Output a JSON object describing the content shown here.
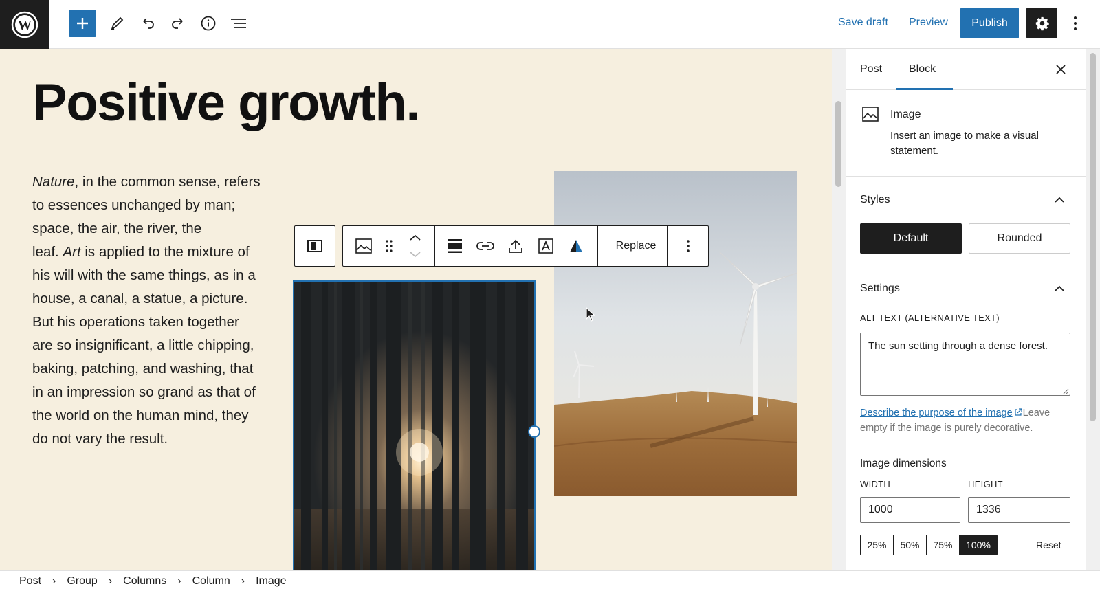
{
  "toolbar": {
    "logo_icon": "wordpress-icon",
    "save_draft": "Save draft",
    "preview": "Preview",
    "publish": "Publish"
  },
  "post": {
    "title": "Positive growth.",
    "paragraph_lines": [
      [
        {
          "t": "Nature",
          "i": true
        },
        {
          "t": ", in the common sense, refers",
          "i": false
        }
      ],
      [
        {
          "t": "to essences unchanged by man;",
          "i": false
        }
      ],
      [
        {
          "t": "space, the air, the river, the",
          "i": false
        }
      ],
      [
        {
          "t": "leaf. ",
          "i": false
        },
        {
          "t": "Art",
          "i": true
        },
        {
          "t": " is applied to the mixture of",
          "i": false
        }
      ],
      [
        {
          "t": "his will with the same things, as in a",
          "i": false
        }
      ],
      [
        {
          "t": "house, a canal, a statue, a picture.",
          "i": false
        }
      ],
      [
        {
          "t": "But his operations taken together",
          "i": false
        }
      ],
      [
        {
          "t": "are so insignificant, a little chipping,",
          "i": false
        }
      ],
      [
        {
          "t": "baking, patching, and washing, that",
          "i": false
        }
      ],
      [
        {
          "t": "in an impression so grand as that of",
          "i": false
        }
      ],
      [
        {
          "t": "the world on the human mind, they",
          "i": false
        }
      ],
      [
        {
          "t": "do not vary the result.",
          "i": false
        }
      ]
    ]
  },
  "block_toolbar": {
    "replace": "Replace"
  },
  "breadcrumb": [
    "Post",
    "Group",
    "Columns",
    "Column",
    "Image"
  ],
  "sidebar": {
    "tabs": {
      "post": "Post",
      "block": "Block"
    },
    "active_tab": "Block",
    "block_name": "Image",
    "block_description": "Insert an image to make a visual statement.",
    "styles": {
      "title": "Styles",
      "default": "Default",
      "rounded": "Rounded",
      "selected": "Default"
    },
    "settings": {
      "title": "Settings",
      "alt_label": "ALT TEXT (ALTERNATIVE TEXT)",
      "alt_value": "The sun setting through a dense forest.",
      "help_link": "Describe the purpose of the image",
      "help_rest": "Leave empty if the image is purely decorative.",
      "dimensions_title": "Image dimensions",
      "width_label": "WIDTH",
      "height_label": "HEIGHT",
      "width_value": "1000",
      "height_value": "1336",
      "percent_options": [
        "25%",
        "50%",
        "75%",
        "100%"
      ],
      "percent_selected": "100%",
      "reset": "Reset"
    }
  },
  "colors": {
    "accent": "#2271b1",
    "canvas_bg": "#f6efdf",
    "dark": "#1e1e1e"
  }
}
